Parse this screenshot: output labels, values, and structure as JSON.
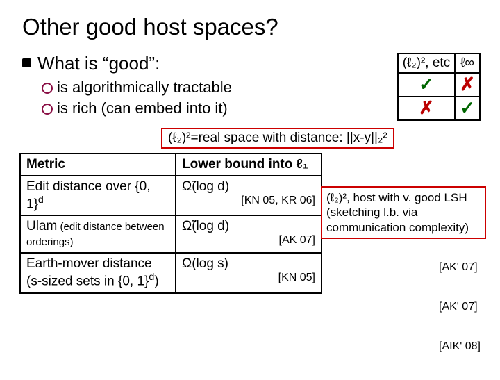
{
  "title": "Other good host spaces?",
  "main_bullet": "What is “good”:",
  "sub_bullets": [
    "is algorithmically tractable",
    "is rich (can embed into it)"
  ],
  "mini_grid": {
    "headers": [
      "(ℓ₂)², etc",
      "ℓ∞"
    ],
    "rows": [
      [
        "✓",
        "✗"
      ],
      [
        "✗",
        "✓"
      ]
    ]
  },
  "def_box": "(ℓ₂)²=real space with distance: ||x-y||₂²",
  "table": {
    "headers": [
      "Metric",
      "Lower bound into ℓ₁"
    ],
    "rows": [
      {
        "metric": "Edit distance over {0, 1}",
        "metric_sup": "d",
        "bound": "Ω̃(log d)",
        "ref": "[KN 05, KR 06]"
      },
      {
        "metric": "Ulam",
        "metric_note": " (edit distance between orderings)",
        "bound": "Ω̃(log d)",
        "ref": "[AK 07]"
      },
      {
        "metric": "Earth-mover distance (s-sized sets in {0, 1}",
        "metric_sup": "d",
        "metric_tail": ")",
        "bound": "Ω(log s)",
        "ref": "[KN 05]"
      }
    ]
  },
  "sidebox": "(ℓ₂)², host with v. good LSH (sketching l.b. via communication complexity)",
  "side_refs": [
    "[AK' 07]",
    "[AK' 07]",
    "[AIK' 08]"
  ]
}
